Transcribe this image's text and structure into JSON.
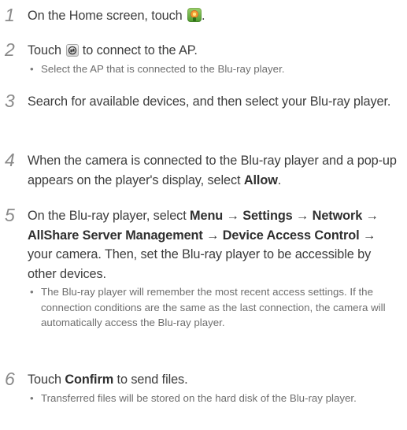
{
  "steps": [
    {
      "num": "1",
      "parts": [
        "On the Home screen, touch ",
        "."
      ],
      "icon": "camera-app-icon"
    },
    {
      "num": "2",
      "parts": [
        "Touch ",
        " to connect to the AP."
      ],
      "icon": "ap-connect-icon",
      "bullets": [
        "Select the AP that is connected to the Blu-ray player."
      ]
    },
    {
      "num": "3",
      "text": "Search for available devices, and then select your Blu-ray player."
    },
    {
      "num": "4",
      "text": "When the camera is connected to the Blu-ray player and a pop-up appears on the player's display, select ",
      "bold": "Allow",
      "end": "."
    },
    {
      "num": "5",
      "prefix": "On the Blu-ray player, select ",
      "b1": "Menu",
      "arrow": " → ",
      "b2": "Settings",
      "b3": "Network",
      "b4": "AllShare Server Management",
      "b5": "Device Access Control",
      "suffix": " your camera. Then, set the Blu-ray player to be accessible by other devices.",
      "bullets": [
        "The Blu-ray player will remember the most recent access settings. If the connection conditions are the same as the last connection, the camera will automatically access the Blu-ray player."
      ]
    },
    {
      "num": "6",
      "pre": "Touch ",
      "bold": "Confirm",
      "post": " to send files.",
      "bullets": [
        "Transferred files will be stored on the hard disk of the Blu-ray player."
      ]
    }
  ],
  "colors": {
    "text": "#3c3c3c",
    "number": "#8a8a8a",
    "bullet": "#6e6e6e"
  }
}
